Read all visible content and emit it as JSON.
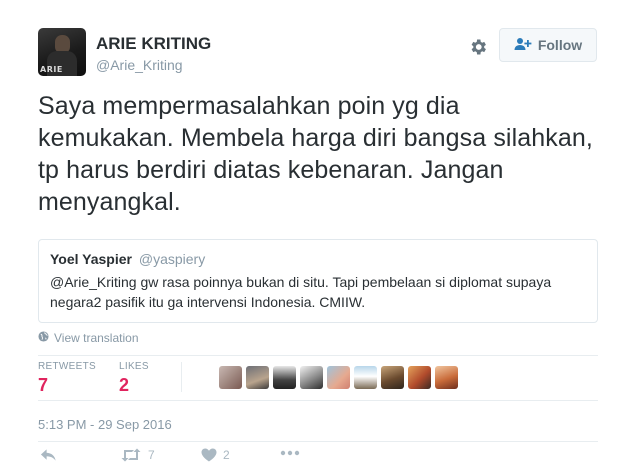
{
  "user": {
    "display_name": "ARIE KRITING",
    "handle": "@Arie_Kriting",
    "avatar_stamp": "ARIE"
  },
  "actions_top": {
    "follow_label": "Follow",
    "settings_icon": "gear-icon",
    "follow_icon": "add-user-icon"
  },
  "tweet": {
    "text": "Saya mempermasalahkan poin yg dia kemukakan. Membela harga diri bangsa silahkan, tp harus berdiri diatas kebenaran. Jangan menyangkal."
  },
  "quoted": {
    "name": "Yoel Yaspier",
    "handle": "@yaspiery",
    "text": "@Arie_Kriting gw rasa poinnya bukan di situ. Tapi pembelaan si diplomat supaya negara2 pasifik itu ga intervensi Indonesia. CMIIW."
  },
  "translation": {
    "label": "View translation",
    "icon": "globe-icon"
  },
  "stats": {
    "retweets_label": "RETWEETS",
    "retweets_value": "7",
    "likes_label": "LIKES",
    "likes_value": "2",
    "liker_avatar_count": 9
  },
  "timestamp": "5:13 PM - 29 Sep 2016",
  "actions": {
    "reply_icon": "reply-icon",
    "retweet_icon": "retweet-icon",
    "retweet_count": "7",
    "like_icon": "heart-icon",
    "like_count": "2",
    "more_icon": "more-icon"
  },
  "colors": {
    "text": "#292f33",
    "muted": "#8899a6",
    "stat_value": "#e0245e",
    "border": "#e1e8ed",
    "action_icon": "#aab8c2"
  }
}
